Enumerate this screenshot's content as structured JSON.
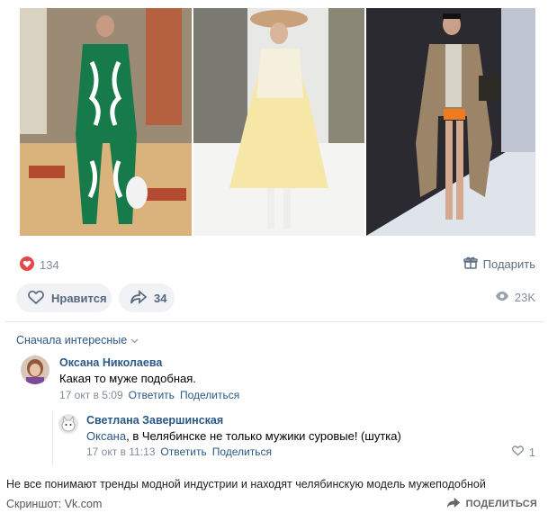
{
  "post": {
    "photos": [
      {
        "name": "runway-photo-green-suit"
      },
      {
        "name": "runway-photo-yellow-dress"
      },
      {
        "name": "runway-photo-trench-coat"
      }
    ],
    "reactions_count": "134",
    "gift_label": "Подарить",
    "like_label": "Нравится",
    "shares_count": "34",
    "views_count": "23K"
  },
  "comments": {
    "sort_label": "Сначала интересные",
    "items": [
      {
        "author": "Оксана Николаева",
        "text": "Какая то муже подобная.",
        "time": "17 окт в 5:09",
        "reply_label": "Ответить",
        "share_label": "Поделиться"
      },
      {
        "author": "Светлана Завершинская",
        "mention": "Оксана",
        "text": ", в Челябинске не только мужики суровые! (шутка)",
        "time": "17 окт в 11:13",
        "reply_label": "Ответить",
        "share_label": "Поделиться",
        "likes": "1"
      }
    ]
  },
  "footer": {
    "caption": "Не все понимают тренды модной индустрии и находят челябинскую модель мужеподобной",
    "source": "Скриншот: Vk.com",
    "share_label": "ПОДЕЛИТЬСЯ"
  },
  "colors": {
    "accent": "#2a5885",
    "heart": "#e64646",
    "muted": "#818c99",
    "pill_bg": "#f0f2f5"
  }
}
